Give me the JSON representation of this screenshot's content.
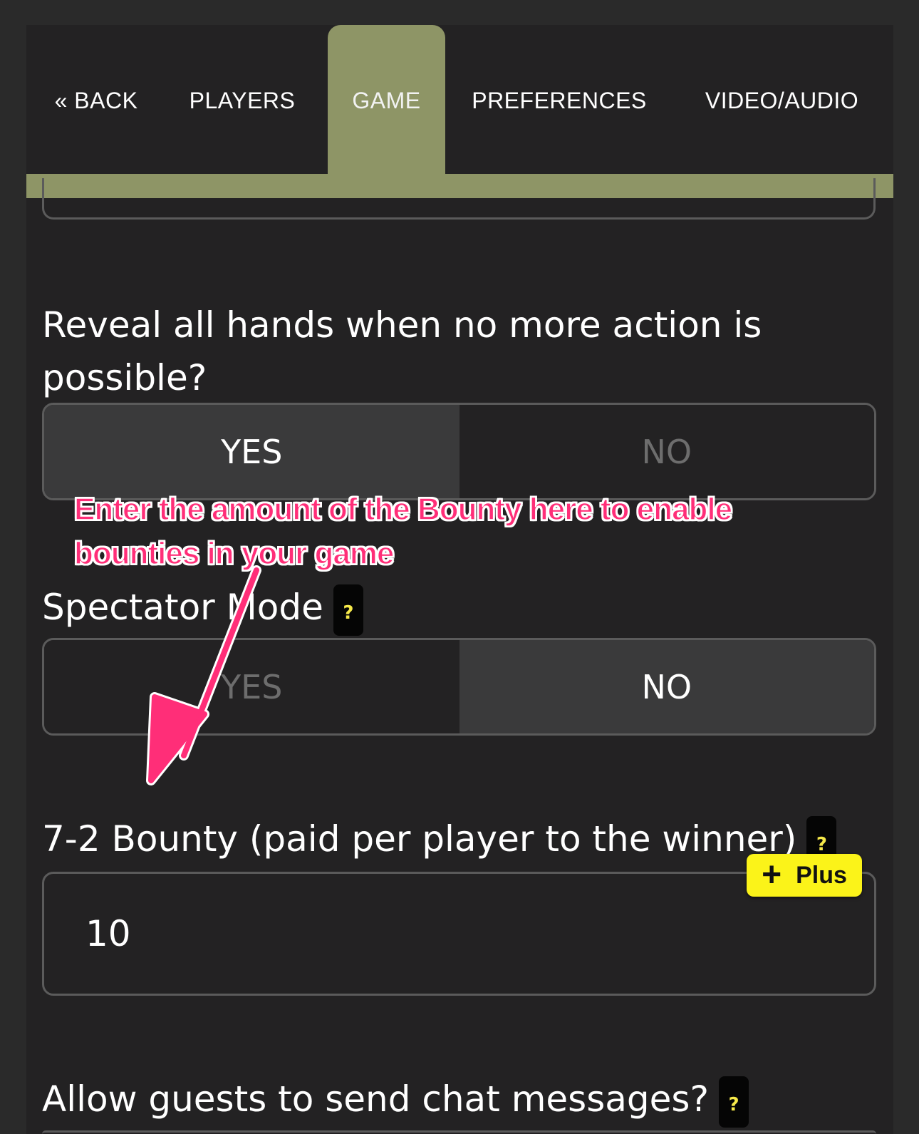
{
  "nav": {
    "tabs": [
      {
        "label": "« BACK",
        "active": false
      },
      {
        "label": "PLAYERS",
        "active": false
      },
      {
        "label": "GAME",
        "active": true
      },
      {
        "label": "PREFERENCES",
        "active": false
      },
      {
        "label": "VIDEO/AUDIO",
        "active": false
      }
    ]
  },
  "settings": {
    "reveal_hands": {
      "question": "Reveal all hands when no more action is possible?",
      "yes_label": "YES",
      "no_label": "NO",
      "selected": "YES"
    },
    "spectator_mode": {
      "question": "Spectator Mode",
      "help": "?",
      "yes_label": "YES",
      "no_label": "NO",
      "selected": "NO"
    },
    "bounty": {
      "question": "7-2 Bounty (paid per player to the winner)",
      "help": "?",
      "value": "10",
      "plus_badge": {
        "sign": "+",
        "label": "Plus"
      }
    },
    "guest_chat": {
      "question": "Allow guests to send chat messages?",
      "help": "?"
    }
  },
  "annotation": {
    "text": "Enter the amount of the Bounty here to enable bounties in your game"
  },
  "colors": {
    "accent": "#8e9566",
    "panel": "#232223",
    "annotation": "#ff2e78",
    "plus_badge": "#fbf319",
    "help_text": "#f6e94a"
  }
}
